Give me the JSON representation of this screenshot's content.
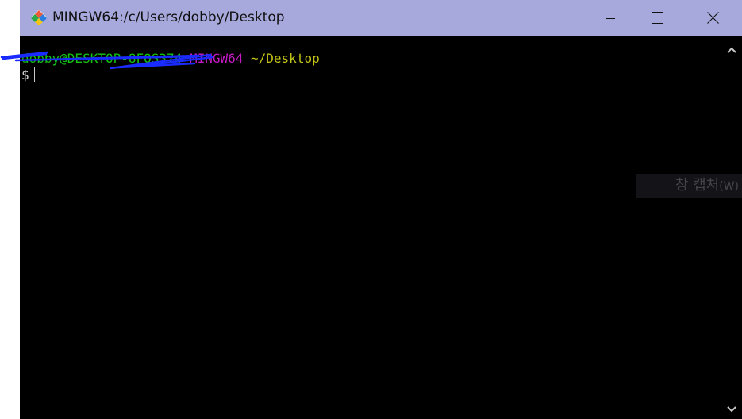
{
  "window": {
    "title": "MINGW64:/c/Users/dobby/Desktop",
    "title_bar_color": "#a7a8dc",
    "app_icon": "git-bash-diamond-icon",
    "controls": {
      "minimize_icon": "minimize-icon",
      "maximize_icon": "maximize-icon",
      "close_icon": "close-icon"
    }
  },
  "terminal": {
    "prompt_user_host": "dobby@DESKTOP-8FOS374",
    "prompt_system": "MINGW64",
    "prompt_path": "~/Desktop",
    "prompt_symbol": "$",
    "colors": {
      "background": "#000000",
      "user_host": "#13c413",
      "system": "#c419c4",
      "path": "#c3c318",
      "redaction_ink": "#1a2bff"
    }
  },
  "scrollbar": {
    "up_icon": "chevron-up-icon",
    "down_icon": "chevron-down-icon"
  },
  "tooltip": {
    "text": "창 캡처",
    "shortcut": "(W)"
  }
}
